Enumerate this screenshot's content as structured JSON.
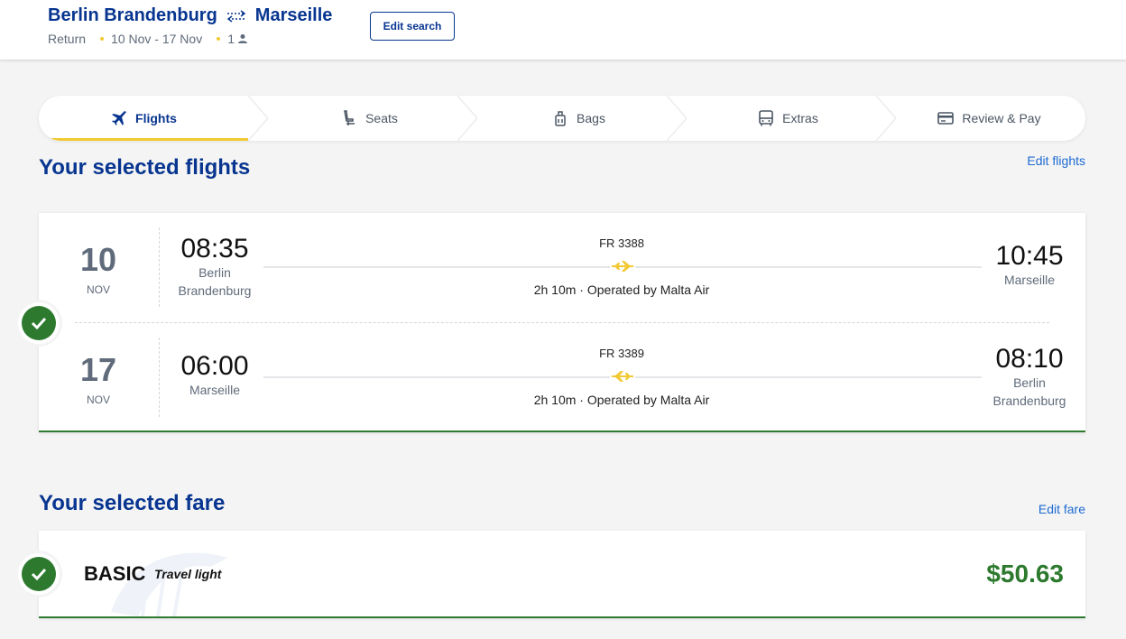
{
  "header": {
    "origin": "Berlin Brandenburg",
    "destination": "Marseille",
    "trip_type": "Return",
    "dates": "10 Nov - 17 Nov",
    "passengers": "1",
    "edit_search_label": "Edit search"
  },
  "stepper": [
    {
      "label": "Flights",
      "icon": "plane-icon",
      "active": true
    },
    {
      "label": "Seats",
      "icon": "seat-icon",
      "active": false
    },
    {
      "label": "Bags",
      "icon": "bag-icon",
      "active": false
    },
    {
      "label": "Extras",
      "icon": "bus-icon",
      "active": false
    },
    {
      "label": "Review & Pay",
      "icon": "card-icon",
      "active": false
    }
  ],
  "flights_section": {
    "title": "Your selected flights",
    "edit_label": "Edit flights",
    "legs": [
      {
        "day": "10",
        "month": "NOV",
        "dep_time": "08:35",
        "dep_city": "Berlin Brandenburg",
        "flight_no": "FR 3388",
        "duration_info": "2h 10m · Operated by Malta Air",
        "arr_time": "10:45",
        "arr_city": "Marseille"
      },
      {
        "day": "17",
        "month": "NOV",
        "dep_time": "06:00",
        "dep_city": "Marseille",
        "flight_no": "FR 3389",
        "duration_info": "2h 10m · Operated by Malta Air",
        "arr_time": "08:10",
        "arr_city": "Berlin Brandenburg"
      }
    ]
  },
  "fare_section": {
    "title": "Your selected fare",
    "edit_label": "Edit fare",
    "fare_name": "BASIC",
    "fare_tagline": "Travel light",
    "price": "$50.63"
  },
  "colors": {
    "brand_blue": "#073590",
    "accent_yellow": "#f1c933",
    "success_green": "#2d7a2f",
    "link_blue": "#1d6ad2"
  }
}
